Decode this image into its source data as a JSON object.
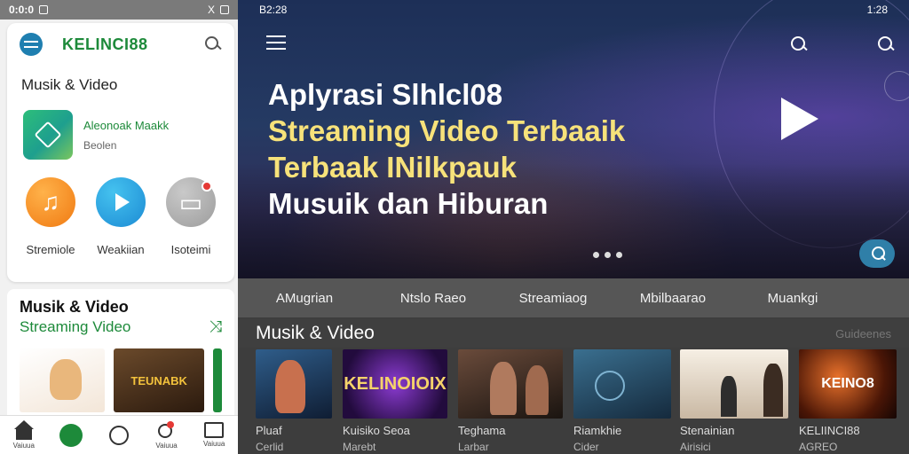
{
  "left": {
    "status_bar": {
      "time": "0:0:0",
      "x_glyph": "X"
    },
    "app_bar": {
      "title": "KELINCI88"
    },
    "section_title": "Musik & Video",
    "featured": {
      "name": "Aleonoak Maakk",
      "sub": "Beolen"
    },
    "categories": [
      {
        "label": "Stremiole",
        "icon": "music-note-icon",
        "color": "#f7931e"
      },
      {
        "label": "Weakiian",
        "icon": "play-icon",
        "color": "#2a9de0"
      },
      {
        "label": "Isoteimi",
        "icon": "cast-icon",
        "color": "#a8a8a8"
      }
    ],
    "promo": {
      "title": "Musik & Video",
      "subtitle": "Streaming Video",
      "thumb2_text": "TEUNABK"
    },
    "bottom_nav": [
      {
        "label": "Vaiuua",
        "icon": "home-icon"
      },
      {
        "label": "",
        "icon": "green-app-icon"
      },
      {
        "label": "",
        "icon": "clock-icon"
      },
      {
        "label": "Vaiuua",
        "icon": "video-icon"
      },
      {
        "label": "Vaiuua",
        "icon": "mail-icon"
      }
    ]
  },
  "right": {
    "status_bar": {
      "time": "B2:28",
      "clock": "1:28"
    },
    "hero": {
      "line1": "Aplyrasi Slhlcl08",
      "line2": "Streaming Video Terbaaik",
      "line3": "Terbaak INilkpauk",
      "line4": "Musuik dan Hiburan"
    },
    "tabs": [
      "AMugrian",
      "Ntslo Raeo",
      "Streamiaog",
      "Mbilbaarao",
      "Muankgi"
    ],
    "row": {
      "title": "Musik & Video",
      "more": "Guideenes"
    },
    "videos": [
      {
        "line1": "Pluaf",
        "line2": "Cerlid"
      },
      {
        "line1": "Kuisiko Seoa",
        "line2": "Marebt",
        "img_text": "KELINOIOIX"
      },
      {
        "line1": "Teghama",
        "line2": "Larbar"
      },
      {
        "line1": "Riamkhie",
        "line2": "Cider"
      },
      {
        "line1": "Stenainian",
        "line2": "Airisici"
      },
      {
        "line1": "KELIINCI88",
        "line2": "AGREO",
        "img_text": "KEINO8"
      }
    ]
  },
  "colors": {
    "brand_green": "#1d8a3a",
    "accent_blue": "#2f7fa8",
    "hero_yellow": "#f7e27a"
  }
}
